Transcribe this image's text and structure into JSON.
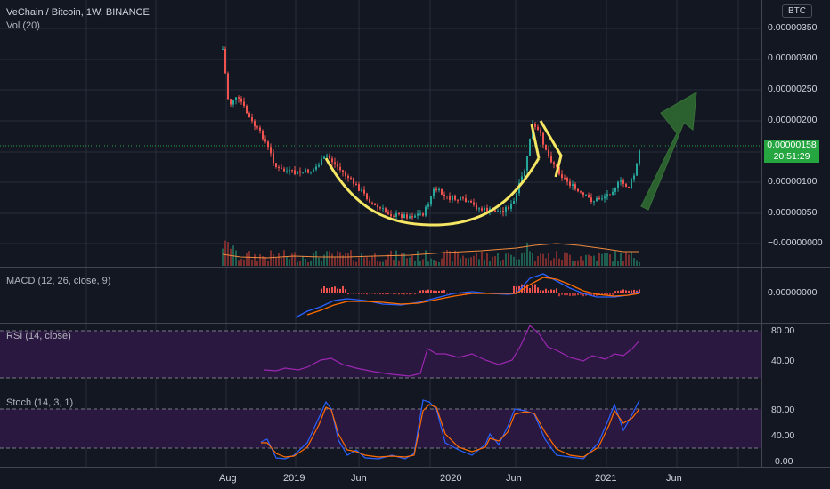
{
  "header": {
    "symbol": "VeChain / Bitcoin, 1W, BINANCE",
    "volume": "Vol (20)",
    "currency": "BTC"
  },
  "price_axis": [
    "0.00000350",
    "0.00000300",
    "0.00000250",
    "0.00000200",
    "0.00000100",
    "0.00000050",
    "−0.00000000"
  ],
  "last_price": {
    "value": "0.00000158",
    "countdown": "20:51:29"
  },
  "macd": {
    "label": "MACD (12, 26, close, 9)",
    "axis": "0.00000000"
  },
  "rsi": {
    "label": "RSI (14, close)",
    "axis": [
      "80.00",
      "40.00"
    ]
  },
  "stoch": {
    "label": "Stoch (14, 3, 1)",
    "axis": [
      "80.00",
      "40.00",
      "0.00"
    ]
  },
  "time_axis": [
    "Aug",
    "2019",
    "Jun",
    "2020",
    "Jun",
    "2021",
    "Jun"
  ],
  "colors": {
    "up": "#26a69a",
    "down": "#ef5350",
    "green": "#4caf50",
    "pattern": "#f5e663",
    "rsi_band": "#2a1840",
    "arrow": "#3b7a3b"
  }
}
